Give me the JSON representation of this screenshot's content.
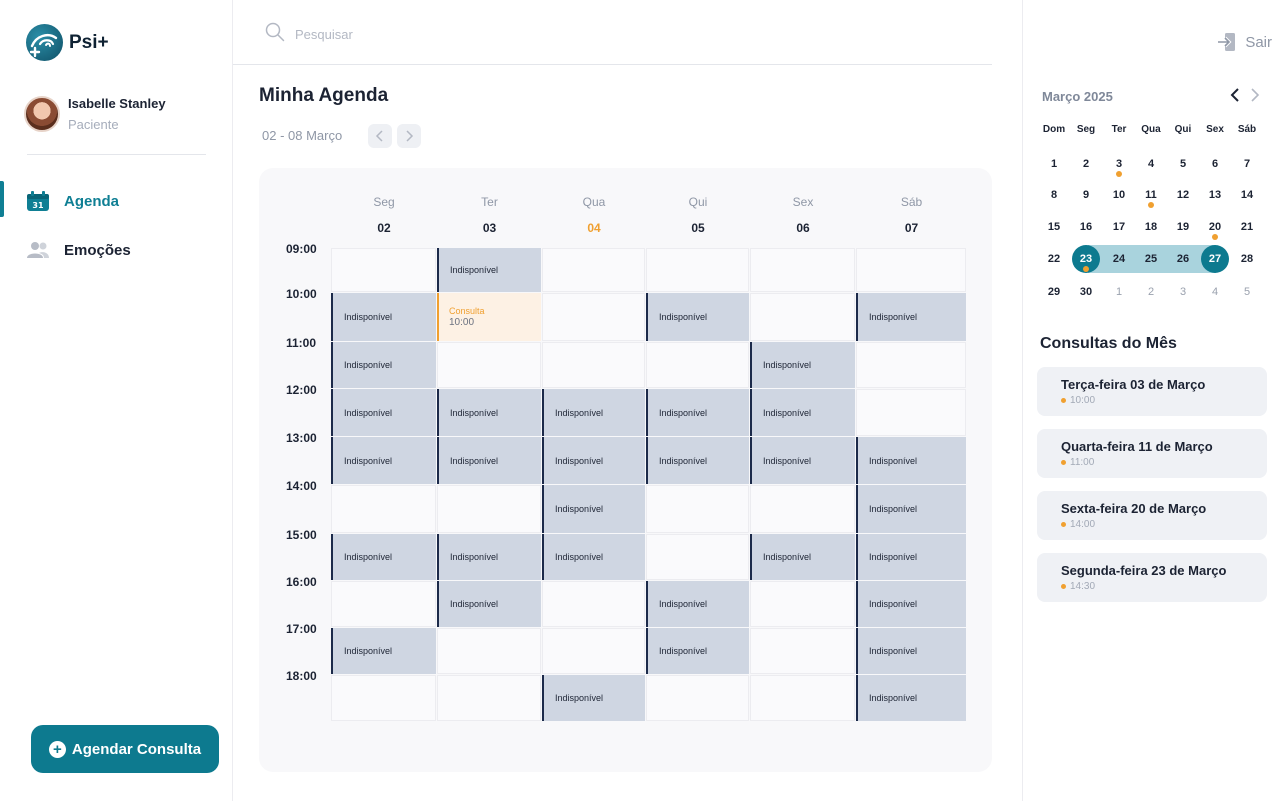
{
  "app": {
    "name": "Psi+"
  },
  "user": {
    "name": "Isabelle Stanley",
    "role": "Paciente"
  },
  "nav": [
    {
      "label": "Agenda",
      "icon": "calendar-icon",
      "active": true
    },
    {
      "label": "Emoções",
      "icon": "people-icon",
      "active": false
    }
  ],
  "cta": {
    "label": "Agendar Consulta"
  },
  "search": {
    "placeholder": "Pesquisar"
  },
  "agenda": {
    "title": "Minha Agenda",
    "week_range": "02 - 08  Março",
    "days": [
      {
        "name": "Seg",
        "num": "02"
      },
      {
        "name": "Ter",
        "num": "03"
      },
      {
        "name": "Qua",
        "num": "04",
        "today": true
      },
      {
        "name": "Qui",
        "num": "05"
      },
      {
        "name": "Sex",
        "num": "06"
      },
      {
        "name": "Sáb",
        "num": "07"
      }
    ],
    "hours": [
      "09:00",
      "10:00",
      "11:00",
      "12:00",
      "13:00",
      "14:00",
      "15:00",
      "16:00",
      "17:00",
      "18:00"
    ],
    "unavailable_label": "Indisponível",
    "unavailable": [
      [
        1,
        0
      ],
      [
        0,
        1
      ],
      [
        3,
        1
      ],
      [
        5,
        1
      ],
      [
        0,
        2
      ],
      [
        4,
        2
      ],
      [
        0,
        3
      ],
      [
        1,
        3
      ],
      [
        2,
        3
      ],
      [
        3,
        3
      ],
      [
        4,
        3
      ],
      [
        0,
        4
      ],
      [
        1,
        4
      ],
      [
        2,
        4
      ],
      [
        3,
        4
      ],
      [
        4,
        4
      ],
      [
        5,
        4
      ],
      [
        2,
        5
      ],
      [
        5,
        5
      ],
      [
        0,
        6
      ],
      [
        1,
        6
      ],
      [
        2,
        6
      ],
      [
        4,
        6
      ],
      [
        5,
        6
      ],
      [
        1,
        7
      ],
      [
        3,
        7
      ],
      [
        5,
        7
      ],
      [
        0,
        8
      ],
      [
        3,
        8
      ],
      [
        5,
        8
      ],
      [
        2,
        9
      ],
      [
        5,
        9
      ]
    ],
    "booked": [
      {
        "day": 1,
        "hour": 1,
        "title": "Consulta",
        "time": "10:00"
      }
    ]
  },
  "right": {
    "logout_label": "Sair",
    "calendar": {
      "title": "Março 2025",
      "weekdays": [
        "Dom",
        "Seg",
        "Ter",
        "Qua",
        "Qui",
        "Sex",
        "Sáb"
      ],
      "weeks": [
        [
          [
            "1",
            ""
          ],
          [
            "2",
            ""
          ],
          [
            "3",
            "dot"
          ],
          [
            "4",
            ""
          ],
          [
            "5",
            ""
          ],
          [
            "6",
            ""
          ],
          [
            "7",
            ""
          ]
        ],
        [
          [
            "8",
            ""
          ],
          [
            "9",
            ""
          ],
          [
            "10",
            ""
          ],
          [
            "11",
            "dot"
          ],
          [
            "12",
            ""
          ],
          [
            "13",
            ""
          ],
          [
            "14",
            ""
          ]
        ],
        [
          [
            "15",
            ""
          ],
          [
            "16",
            ""
          ],
          [
            "17",
            ""
          ],
          [
            "18",
            ""
          ],
          [
            "19",
            ""
          ],
          [
            "20",
            "dot"
          ],
          [
            "21",
            ""
          ]
        ],
        [
          [
            "22",
            ""
          ],
          [
            "23",
            "start"
          ],
          [
            "24",
            "range"
          ],
          [
            "25",
            "range"
          ],
          [
            "26",
            "range"
          ],
          [
            "27",
            "end"
          ],
          [
            "28",
            ""
          ]
        ],
        [
          [
            "29",
            ""
          ],
          [
            "30",
            ""
          ],
          [
            "1",
            "dim"
          ],
          [
            "2",
            "dim"
          ],
          [
            "3",
            "dim"
          ],
          [
            "4",
            "dim"
          ],
          [
            "5",
            "dim"
          ]
        ]
      ]
    },
    "month_title": "Consultas do Mês",
    "consultations": [
      {
        "title": "Terça-feira 03 de Março",
        "time": "10:00"
      },
      {
        "title": "Quarta-feira 11 de Março",
        "time": "11:00"
      },
      {
        "title": "Sexta-feira 20 de Março",
        "time": "14:00"
      },
      {
        "title": "Segunda-feira 23 de Março",
        "time": "14:30"
      }
    ]
  },
  "colors": {
    "brand": "#0d7a8f",
    "accent": "#f0a030",
    "slot": "#cfd6e2"
  }
}
